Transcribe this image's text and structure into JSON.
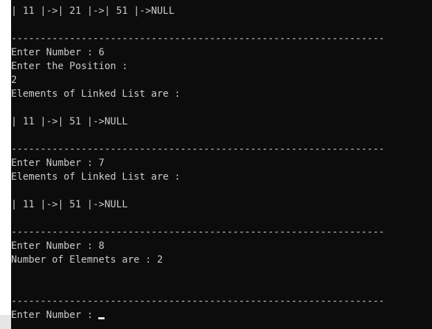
{
  "console": {
    "lines": {
      "l1": "| 11 |->| 21 |->| 51 |->NULL",
      "sep1": "----------------------------------------------------------------",
      "l2": "Enter Number : 6",
      "l3": "Enter the Position :",
      "l4": "2",
      "l5": "Elements of Linked List are :",
      "l6": "| 11 |->| 51 |->NULL",
      "sep2": "----------------------------------------------------------------",
      "l7": "Enter Number : 7",
      "l8": "Elements of Linked List are :",
      "l9": "| 11 |->| 51 |->NULL",
      "sep3": "----------------------------------------------------------------",
      "l10": "Enter Number : 8",
      "l11": "Number of Elemnets are : 2",
      "sep4": "----------------------------------------------------------------",
      "prompt": "Enter Number : "
    }
  },
  "colors": {
    "background": "#0c0c0c",
    "text": "#cccccc",
    "cursor": "#f0f0f0"
  }
}
